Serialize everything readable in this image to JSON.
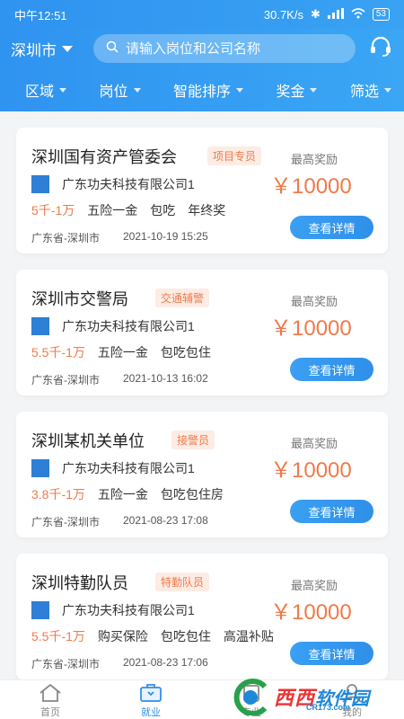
{
  "status_bar": {
    "time": "中午12:51",
    "network_speed": "30.7K/s",
    "battery": "53"
  },
  "header": {
    "city": "深圳市",
    "search_placeholder": "请输入岗位和公司名称",
    "filters": [
      "区域",
      "岗位",
      "智能排序",
      "奖金",
      "筛选"
    ]
  },
  "jobs": [
    {
      "title": "深圳国有资产管委会",
      "tag": "项目专员",
      "company_logo": "功夫科技",
      "company": "广东功夫科技有限公司1",
      "salary": "5千-1万",
      "benefits": [
        "五险一金",
        "包吃",
        "年终奖"
      ],
      "location": "广东省-深圳市",
      "date": "2021-10-19 15:25",
      "reward_label": "最高奖励",
      "reward": "￥10000",
      "button": "查看详情"
    },
    {
      "title": "深圳市交警局",
      "tag": "交通辅警",
      "company_logo": "功夫科技",
      "company": "广东功夫科技有限公司1",
      "salary": "5.5千-1万",
      "benefits": [
        "五险一金",
        "包吃包住"
      ],
      "location": "广东省-深圳市",
      "date": "2021-10-13 16:02",
      "reward_label": "最高奖励",
      "reward": "￥10000",
      "button": "查看详情"
    },
    {
      "title": "深圳某机关单位",
      "tag": "接警员",
      "company_logo": "功夫科技",
      "company": "广东功夫科技有限公司1",
      "salary": "3.8千-1万",
      "benefits": [
        "五险一金",
        "包吃包住房"
      ],
      "location": "广东省-深圳市",
      "date": "2021-08-23 17:08",
      "reward_label": "最高奖励",
      "reward": "￥10000",
      "button": "查看详情"
    },
    {
      "title": "深圳特勤队员",
      "tag": "特勤队员",
      "company_logo": "功夫科技",
      "company": "广东功夫科技有限公司1",
      "salary": "5.5千-1万",
      "benefits": [
        "购买保险",
        "包吃包住",
        "高温补贴"
      ],
      "location": "广东省-深圳市",
      "date": "2021-08-23 17:06",
      "reward_label": "最高奖励",
      "reward": "￥10000",
      "button": "查看详情"
    }
  ],
  "tabbar": [
    {
      "label": "首页",
      "icon": "home-icon"
    },
    {
      "label": "就业",
      "icon": "briefcase-icon",
      "active": true
    },
    {
      "label": "专业",
      "icon": "book-icon"
    },
    {
      "label": "我的",
      "icon": "user-icon"
    }
  ],
  "watermark": {
    "brand": "西西",
    "brand2": "软件园",
    "url": "CR173.com"
  },
  "colors": {
    "primary": "#2f93f0",
    "accent": "#f07a4a"
  }
}
